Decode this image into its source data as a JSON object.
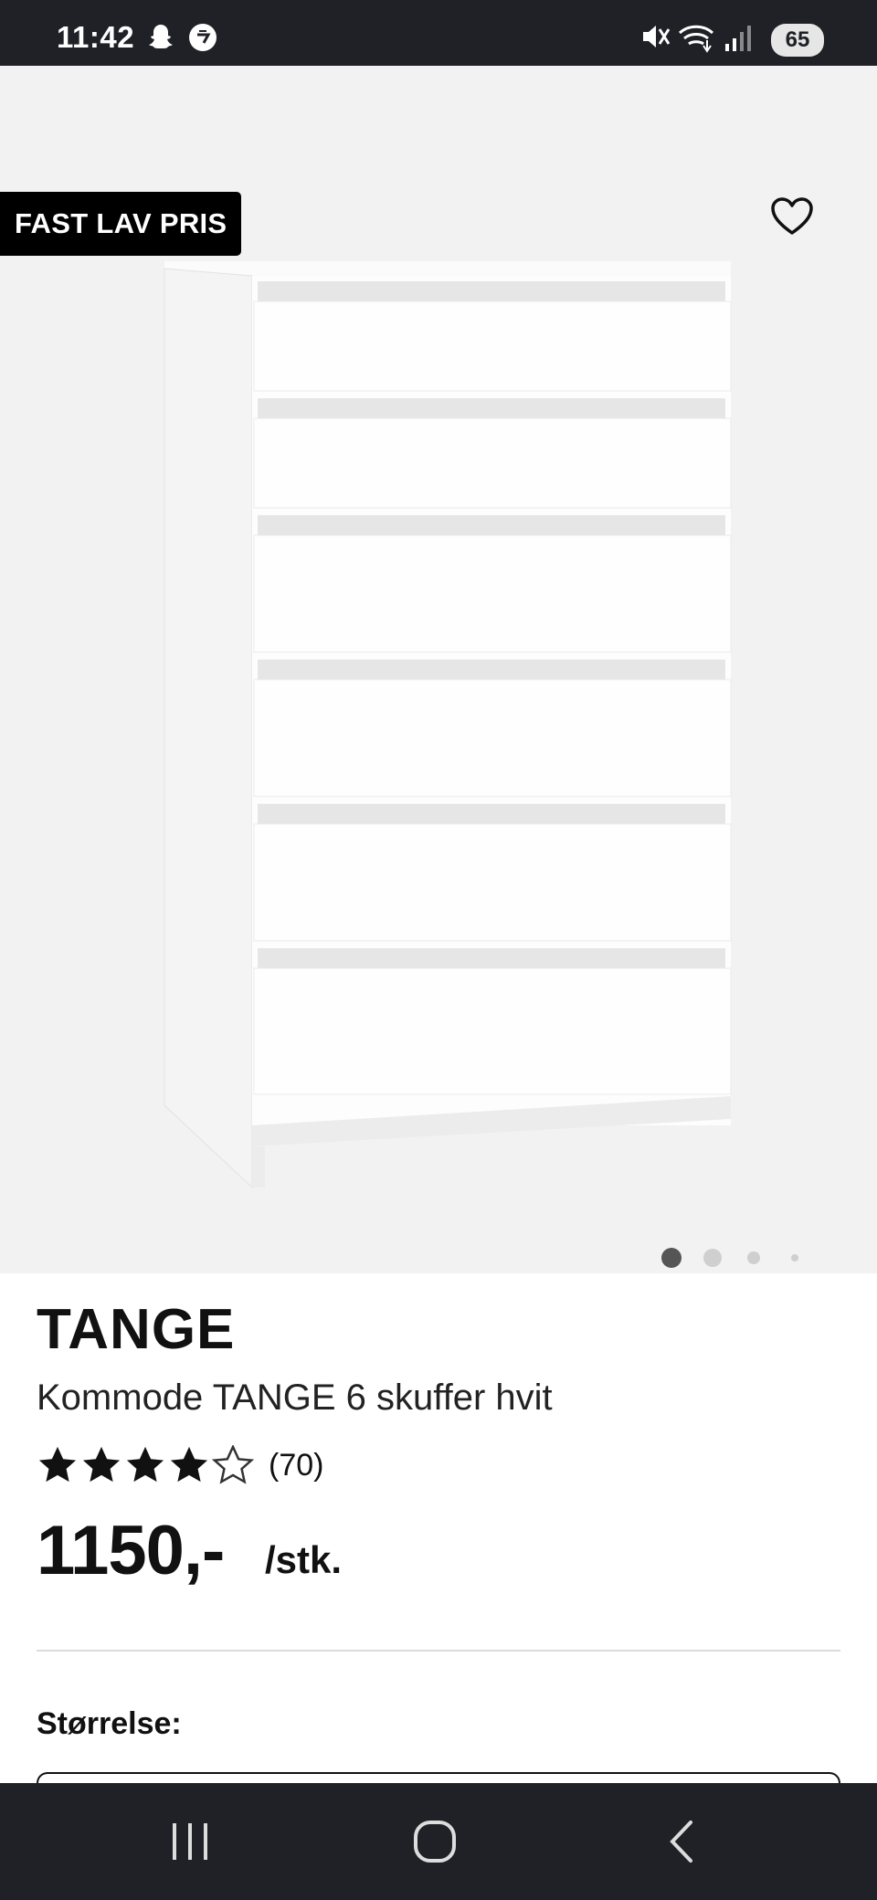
{
  "status_bar": {
    "time": "11:42",
    "left_icons": [
      "snapchat-icon",
      "messenger-icon"
    ],
    "right_icons": [
      "mute-icon",
      "wifi-icon",
      "signal-icon"
    ],
    "battery": "65"
  },
  "product_image": {
    "badge": "FAST LAV PRIS",
    "favorite_icon": "heart-icon",
    "carousel_dots": 4,
    "carousel_active_index": 0
  },
  "product": {
    "brand": "TANGE",
    "name": "Kommode TANGE 6 skuffer hvit",
    "rating_value": 4,
    "rating_max": 5,
    "review_count": "(70)",
    "price": "1150,-",
    "unit": "/stk."
  },
  "options": {
    "size_label": "Størrelse:"
  },
  "nav_bar": {
    "buttons": [
      "recent-apps-icon",
      "home-icon",
      "back-icon"
    ]
  },
  "colors": {
    "status_bar_bg": "#1f2126",
    "image_bg": "#f2f2f2",
    "badge_bg": "#000000",
    "text": "#111111"
  }
}
